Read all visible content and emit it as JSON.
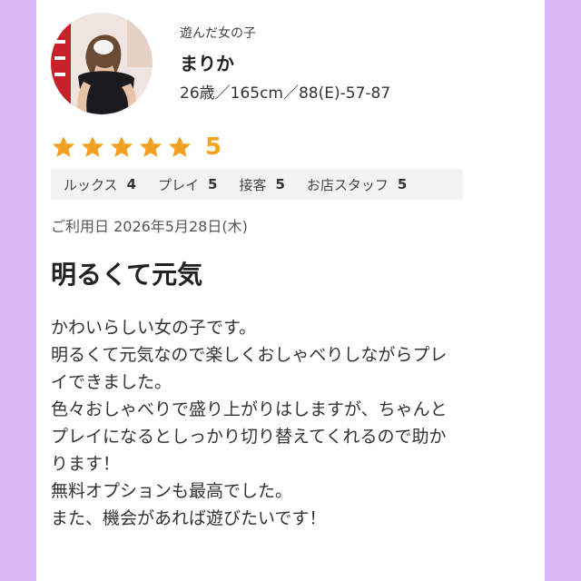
{
  "header": {
    "caption": "遊んだ女の子",
    "name": "まりか",
    "spec": "26歳／165cm／88(E)-57-87"
  },
  "rating": {
    "stars": 5,
    "max": 5,
    "score": "5",
    "star_color": "#f2a21e"
  },
  "sub_ratings": [
    {
      "label": "ルックス",
      "value": "4"
    },
    {
      "label": "プレイ",
      "value": "5"
    },
    {
      "label": "接客",
      "value": "5"
    },
    {
      "label": "お店スタッフ",
      "value": "5"
    }
  ],
  "review": {
    "date": "ご利用日 2026年5月28日(木)",
    "title": "明るくて元気",
    "body_lines": [
      "かわいらしい女の子です。",
      "明るくて元気なので楽しくおしゃべりしながらプレ",
      "イできました。",
      "色々おしゃべりで盛り上がりはしますが、ちゃんと",
      "プレイになるとしっかり切り替えてくれるので助か",
      "ります！",
      "無料オプションも最高でした。",
      "また、機会があれば遊びたいです！"
    ]
  },
  "colors": {
    "background": "#d9b7f2",
    "card": "#ffffff",
    "accent": "#f2a21e"
  },
  "icons": [
    "avatar-photo",
    "star-icon"
  ]
}
